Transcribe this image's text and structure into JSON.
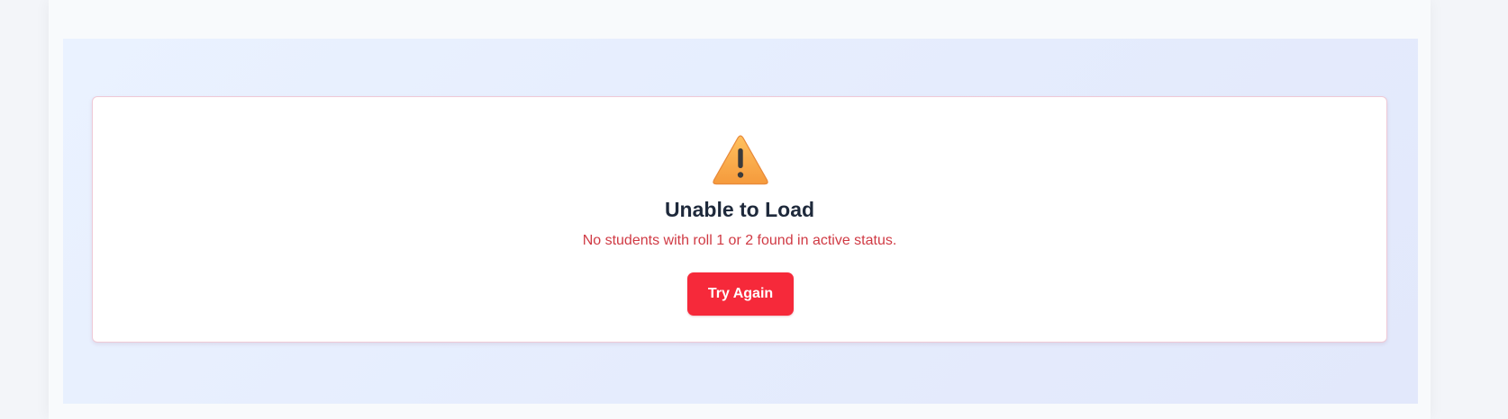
{
  "error_state": {
    "icon": "warning-triangle-icon",
    "title": "Unable to Load",
    "message": "No students with roll 1 or 2 found in active status.",
    "retry_label": "Try Again"
  },
  "colors": {
    "page_background": "#f3f5f9",
    "panel_background": "#f8fafc",
    "content_gradient_start": "#eaf2ff",
    "content_gradient_end": "#e2e8fb",
    "card_border": "#efc9d6",
    "title": "#1e293b",
    "message": "#d03a44",
    "button": "#f6293a",
    "icon_fill": "#f7a84a",
    "icon_mark": "#3b3b3b"
  }
}
